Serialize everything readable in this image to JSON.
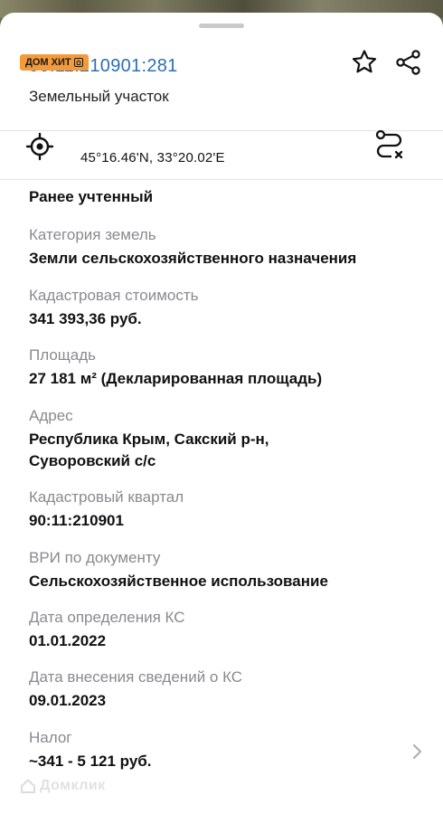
{
  "header": {
    "cadastral_number": "90:11:210901:281",
    "badge_text": "ДОМ ХИТ",
    "subtitle": "Земельный участок"
  },
  "icons": {
    "favorite": "star-icon",
    "share": "share-icon",
    "location": "target-icon",
    "route": "route-icon",
    "more": "chevron-right-icon"
  },
  "coordinates": {
    "text": "45°16.46'N, 33°20.02'E"
  },
  "status": "Ранее учтенный",
  "fields": [
    {
      "label": "Категория земель",
      "value": "Земли сельскохозяйственного назначения"
    },
    {
      "label": "Кадастровая стоимость",
      "value": "341 393,36 руб."
    },
    {
      "label": "Площадь",
      "value": "27 181 м² (Декларированная площадь)"
    },
    {
      "label": "Адрес",
      "value": "Республика Крым, Сакский р-н, Суворовский с/с"
    },
    {
      "label": "Кадастровый квартал",
      "value": "90:11:210901"
    },
    {
      "label": "ВРИ по документу",
      "value": "Сельскохозяйственное использование"
    },
    {
      "label": "Дата определения КС",
      "value": "01.01.2022"
    },
    {
      "label": "Дата внесения сведений о КС",
      "value": "09.01.2023"
    },
    {
      "label": "Налог",
      "value": "~341 - 5 121 руб."
    }
  ],
  "watermark": "Домклик",
  "colors": {
    "accent_link": "#2f6db5",
    "badge": "#f39a3b",
    "label_gray": "#8a8a8e"
  }
}
